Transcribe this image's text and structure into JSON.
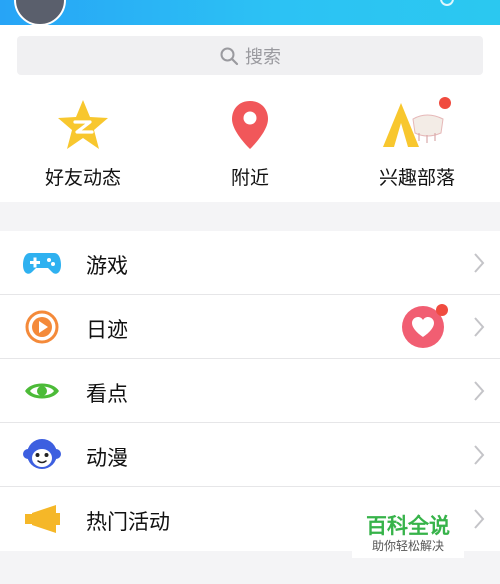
{
  "header": {
    "title_partial": ""
  },
  "search": {
    "placeholder": "搜索",
    "icon": "search-icon"
  },
  "quick_actions": [
    {
      "label": "好友动态",
      "icon": "qzone-star-icon",
      "badge": false
    },
    {
      "label": "附近",
      "icon": "location-pin-icon",
      "badge": false
    },
    {
      "label": "兴趣部落",
      "icon": "tent-icon",
      "badge": true
    }
  ],
  "menu": [
    {
      "label": "游戏",
      "icon": "gamepad-icon",
      "color": "#2fb1f0"
    },
    {
      "label": "日迹",
      "icon": "play-circle-icon",
      "color": "#f48a3a",
      "extra": "heart-badge-icon"
    },
    {
      "label": "看点",
      "icon": "eye-icon",
      "color": "#4cbb38"
    },
    {
      "label": "动漫",
      "icon": "monkey-face-icon",
      "color": "#3d5fe0"
    },
    {
      "label": "热门活动",
      "icon": "megaphone-icon",
      "color": "#f5b728"
    }
  ],
  "colors": {
    "header_start": "#27a4f6",
    "header_end": "#2bc8f0",
    "badge": "#f04b3f",
    "heart": "#f15e72"
  },
  "watermark": {
    "title": "百科全说",
    "subtitle": "助你轻松解决"
  }
}
